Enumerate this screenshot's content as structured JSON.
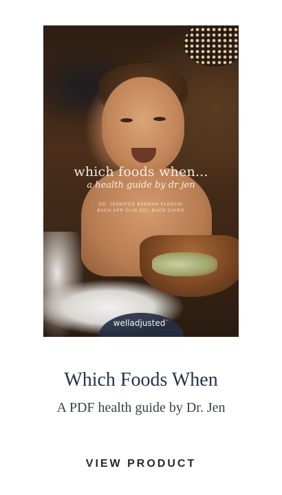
{
  "product": {
    "cover": {
      "title": "which foods when...",
      "subtitle": "a health guide by dr jen",
      "author_line_1": "DR. JENNIFER BARRAH-FLORANI",
      "author_line_2": "BACH APP CLIN SCI, BACH CHIRO",
      "brand": "welladjusted"
    },
    "title": "Which Foods When",
    "subtitle": "A PDF health guide by Dr. Jen",
    "cta_label": "VIEW PRODUCT"
  }
}
